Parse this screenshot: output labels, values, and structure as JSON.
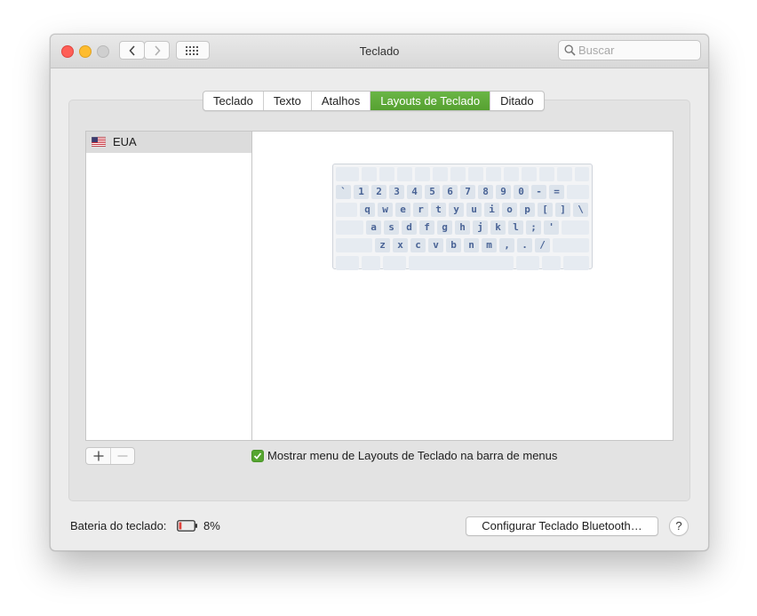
{
  "window": {
    "title": "Teclado"
  },
  "toolbar": {
    "back_icon": "chevron-left-icon",
    "forward_icon": "chevron-right-icon",
    "show_all_icon": "grid-icon"
  },
  "search": {
    "placeholder": "Buscar",
    "value": ""
  },
  "tabs": [
    {
      "label": "Teclado",
      "active": false
    },
    {
      "label": "Texto",
      "active": false
    },
    {
      "label": "Atalhos",
      "active": false
    },
    {
      "label": "Layouts de Teclado",
      "active": true
    },
    {
      "label": "Ditado",
      "active": false
    }
  ],
  "layouts_list": [
    {
      "flag": "us-flag-icon",
      "label": "EUA",
      "selected": true
    }
  ],
  "keyboard_preview": {
    "rows": [
      [
        "`",
        "1",
        "2",
        "3",
        "4",
        "5",
        "6",
        "7",
        "8",
        "9",
        "0",
        "-",
        "="
      ],
      [
        "q",
        "w",
        "e",
        "r",
        "t",
        "y",
        "u",
        "i",
        "o",
        "p",
        "[",
        "]",
        "\\"
      ],
      [
        "a",
        "s",
        "d",
        "f",
        "g",
        "h",
        "j",
        "k",
        "l",
        ";",
        "'"
      ],
      [
        "z",
        "x",
        "c",
        "v",
        "b",
        "n",
        "m",
        ",",
        ".",
        "/"
      ]
    ]
  },
  "buttons": {
    "add_label": "+",
    "remove_label": "−"
  },
  "show_menu_checkbox": {
    "label": "Mostrar menu de Layouts de Teclado na barra de menus",
    "checked": true
  },
  "footer": {
    "battery_label": "Bateria do teclado:",
    "battery_percent": "8%",
    "battery_level": 0.08,
    "bluetooth_button": "Configurar Teclado Bluetooth…",
    "help_label": "?"
  },
  "colors": {
    "accent_green": "#56a131",
    "key_text": "#4a6496",
    "battery_red": "#e0443e"
  }
}
